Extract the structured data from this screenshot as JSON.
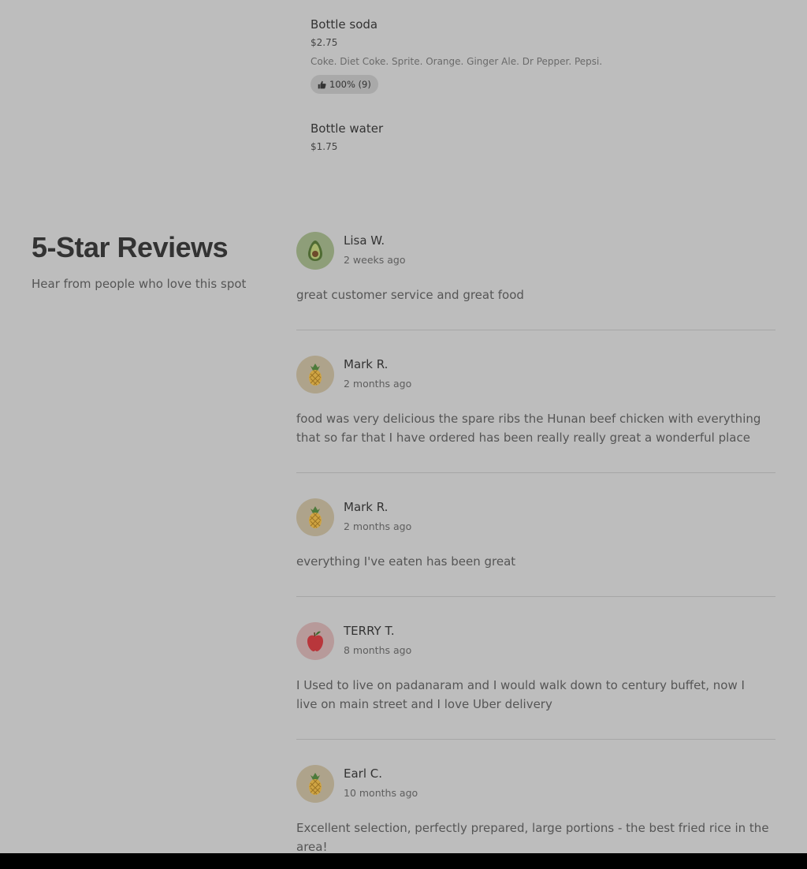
{
  "menu_items": [
    {
      "name": "Bottle soda",
      "price": "$2.75",
      "description": "Coke. Diet Coke. Sprite. Orange. Ginger Ale. Dr Pepper. Pepsi.",
      "rating": "100% (9)"
    },
    {
      "name": "Bottle water",
      "price": "$1.75"
    }
  ],
  "reviews_section": {
    "title": "5-Star Reviews",
    "subtitle": "Hear from people who love this spot"
  },
  "reviews": [
    {
      "name": "Lisa W.",
      "time": "2 weeks ago",
      "text": "great customer service and great food",
      "avatar": "avocado-icon"
    },
    {
      "name": "Mark R.",
      "time": "2 months ago",
      "text": "food was very delicious the spare ribs the Hunan beef chicken with everything that so far that I have ordered has been really really great a wonderful place",
      "avatar": "pineapple-icon"
    },
    {
      "name": "Mark R.",
      "time": "2 months ago",
      "text": "everything I've eaten has been great",
      "avatar": "pineapple-icon"
    },
    {
      "name": "TERRY T.",
      "time": "8 months ago",
      "text": "I Used to live on padanaram and I would walk down to century buffet, now I live on main street and I love Uber delivery",
      "avatar": "apple-icon"
    },
    {
      "name": "Earl C.",
      "time": "10 months ago",
      "text": "Excellent selection, perfectly prepared, large portions - the best fried rice in the area!",
      "avatar": "pineapple-icon"
    }
  ],
  "colors": {
    "page_background": "#bdbdbd",
    "divider": "#a6a6a6",
    "bottom_bar": "#000000"
  }
}
